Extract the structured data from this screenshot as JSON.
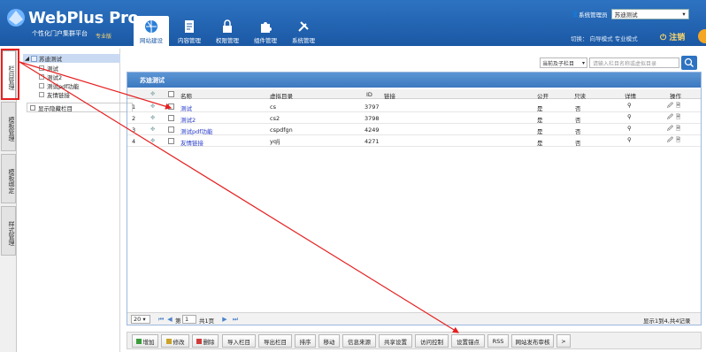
{
  "header": {
    "logo_title": "WebPlus Pro",
    "logo_sub": "个性化门户集群平台",
    "logo_version": "专业版",
    "nav": [
      {
        "label": "网站建设",
        "icon": "globe-icon"
      },
      {
        "label": "内容管理",
        "icon": "document-edit-icon"
      },
      {
        "label": "权限管理",
        "icon": "lock-icon"
      },
      {
        "label": "组件管理",
        "icon": "puzzle-icon"
      },
      {
        "label": "系统管理",
        "icon": "tools-icon"
      }
    ],
    "admin_label": "系统管理员",
    "site_select": "苏迪测试",
    "switch_text": "切换：  向导模式  专业模式",
    "logout": "注销"
  },
  "vtabs": [
    "栏目管理",
    "模板管理",
    "模板绑定",
    "样式管理"
  ],
  "tree": {
    "root": "苏迪测试",
    "children": [
      "测试",
      "测试2",
      "测试pdf功能",
      "友情链接"
    ],
    "show_hidden": "显示隐藏栏目"
  },
  "search": {
    "scope": "当前及子栏目",
    "placeholder": "请输入栏目名称或虚拟目录"
  },
  "grid": {
    "title": "苏迪测试",
    "headers": {
      "name": "名称",
      "virtual": "虚拟目录",
      "id": "ID",
      "link": "链接",
      "public": "公开",
      "readonly": "只读",
      "detail": "详情",
      "action": "操作"
    },
    "rows": [
      {
        "idx": "1",
        "name": "测试",
        "virtual": "cs",
        "id": "3797",
        "public": "是",
        "readonly": "否"
      },
      {
        "idx": "2",
        "name": "测试2",
        "virtual": "cs2",
        "id": "3798",
        "public": "是",
        "readonly": "否"
      },
      {
        "idx": "3",
        "name": "测试pdf功能",
        "virtual": "cspdfgn",
        "id": "4249",
        "public": "是",
        "readonly": "否"
      },
      {
        "idx": "4",
        "name": "友情链接",
        "virtual": "yqlj",
        "id": "4271",
        "public": "是",
        "readonly": "否"
      }
    ],
    "pager": {
      "page_size": "20",
      "page_prefix": "第",
      "page": "1",
      "total_pages": "共1页",
      "summary": "显示1到4,共4记录"
    }
  },
  "toolbar": [
    "增加",
    "修改",
    "删除",
    "导入栏目",
    "导出栏目",
    "排序",
    "移动",
    "信息来源",
    "共享设置",
    "访问控制",
    "设置锚点",
    "RSS",
    "网站发布审核",
    ">"
  ],
  "colors": {
    "header": "#1b58a4",
    "annotation": "#e62020",
    "link": "#2236c9"
  }
}
